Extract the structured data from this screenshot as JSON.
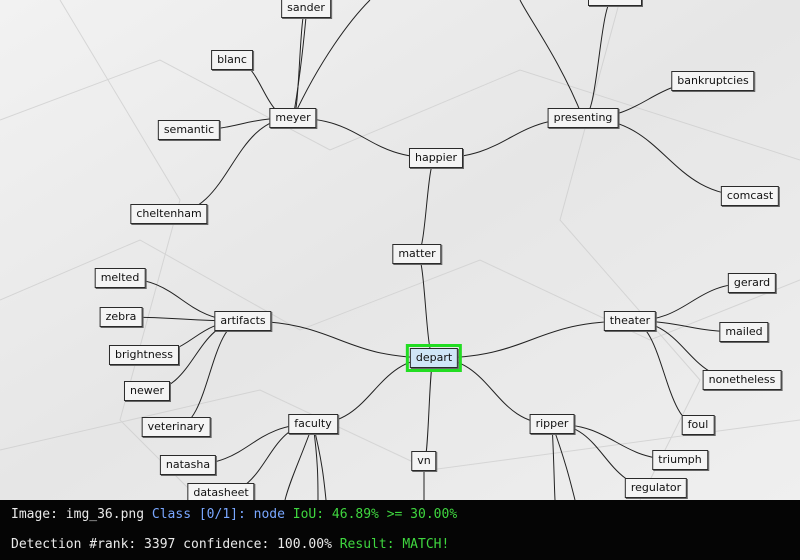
{
  "nodes": {
    "sander": "sander",
    "top-right": "",
    "blanc": "blanc",
    "meyer": "meyer",
    "semantic": "semantic",
    "cheltenham": "cheltenham",
    "happier": "happier",
    "presenting": "presenting",
    "bankruptcies": "bankruptcies",
    "comcast": "comcast",
    "matter": "matter",
    "melted": "melted",
    "zebra": "zebra",
    "artifacts": "artifacts",
    "brightness": "brightness",
    "newer": "newer",
    "veterinary": "veterinary",
    "depart": "depart",
    "theater": "theater",
    "gerard": "gerard",
    "mailed": "mailed",
    "nonetheless": "nonetheless",
    "foul": "foul",
    "faculty": "faculty",
    "natasha": "natasha",
    "datasheet": "datasheet",
    "vn": "vn",
    "ripper": "ripper",
    "triumph": "triumph",
    "regulator": "regulator"
  },
  "edges": [
    [
      "depart",
      "matter"
    ],
    [
      "matter",
      "happier"
    ],
    [
      "happier",
      "meyer"
    ],
    [
      "happier",
      "presenting"
    ],
    [
      "meyer",
      "sander"
    ],
    [
      "meyer",
      "blanc"
    ],
    [
      "meyer",
      "semantic"
    ],
    [
      "meyer",
      "cheltenham"
    ],
    [
      "presenting",
      "bankruptcies"
    ],
    [
      "presenting",
      "comcast"
    ],
    [
      "presenting",
      "top-right"
    ],
    [
      "depart",
      "artifacts"
    ],
    [
      "artifacts",
      "melted"
    ],
    [
      "artifacts",
      "zebra"
    ],
    [
      "artifacts",
      "brightness"
    ],
    [
      "artifacts",
      "newer"
    ],
    [
      "artifacts",
      "veterinary"
    ],
    [
      "depart",
      "theater"
    ],
    [
      "theater",
      "gerard"
    ],
    [
      "theater",
      "mailed"
    ],
    [
      "theater",
      "nonetheless"
    ],
    [
      "theater",
      "foul"
    ],
    [
      "depart",
      "faculty"
    ],
    [
      "faculty",
      "natasha"
    ],
    [
      "faculty",
      "datasheet"
    ],
    [
      "depart",
      "vn"
    ],
    [
      "depart",
      "ripper"
    ],
    [
      "ripper",
      "triumph"
    ],
    [
      "ripper",
      "regulator"
    ]
  ],
  "highlighted": "depart",
  "colors": {
    "highlight": "#22dd22",
    "status_bg": "#050505",
    "class_text": "#79a7ff",
    "ok_text": "#3fd63f"
  },
  "status": {
    "image_label": "Image: img_36.png",
    "class_label": "Class [0/1]: node",
    "iou_label": "IoU: 46.89% >= 30.00%",
    "rank_label": "Detection #rank: 3397 confidence: 100.00%",
    "result_label": "Result: MATCH!"
  }
}
